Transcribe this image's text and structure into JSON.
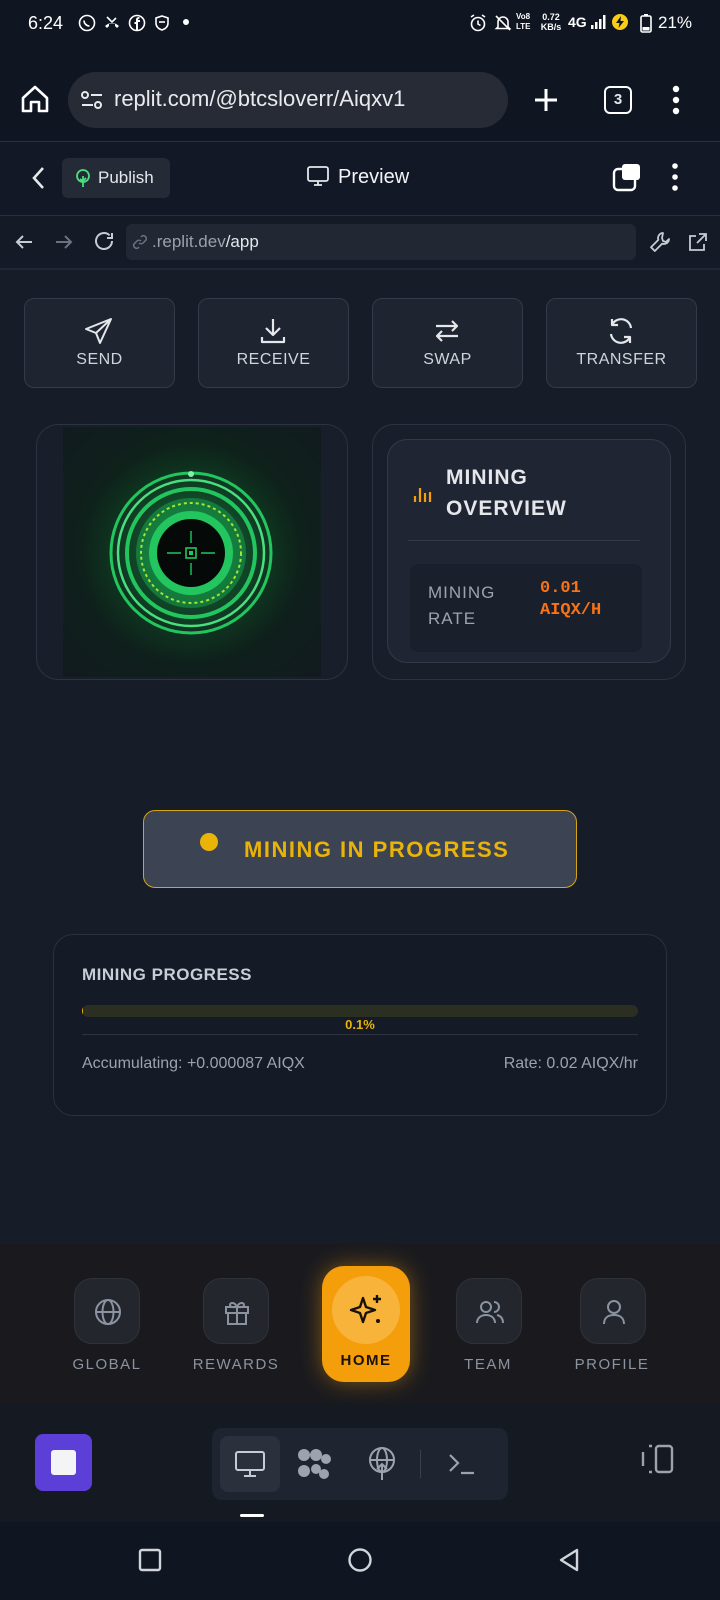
{
  "status_bar": {
    "time": "6:24",
    "network_speed_value": "0.72",
    "network_speed_unit": "KB/s",
    "volte": "Vo8 LTE",
    "signal_type": "4G",
    "battery": "21%"
  },
  "browser": {
    "url": "replit.com/@btcsloverr/Aiqxv1",
    "tab_count": "3"
  },
  "replit_header": {
    "publish_label": "Publish",
    "preview_label": "Preview"
  },
  "preview_bar": {
    "url_domain": ".replit.dev",
    "url_path": "/app"
  },
  "actions": [
    {
      "label": "SEND",
      "icon": "send-icon"
    },
    {
      "label": "RECEIVE",
      "icon": "download-icon"
    },
    {
      "label": "SWAP",
      "icon": "swap-icon"
    },
    {
      "label": "TRANSFER",
      "icon": "refresh-icon"
    }
  ],
  "overview": {
    "title_line1": "MINING",
    "title_line2": "OVERVIEW",
    "rate_label_line1": "MINING",
    "rate_label_line2": "RATE",
    "rate_value_line1": "0.01",
    "rate_value_line2": "AIQX/H"
  },
  "mining_button": {
    "label": "MINING IN PROGRESS"
  },
  "progress": {
    "title": "MINING PROGRESS",
    "percent_label": "0.1%",
    "percent_value": 0.1,
    "accumulating": "Accumulating: +0.000087 AIQX",
    "rate": "Rate: 0.02 AIQX/hr"
  },
  "bottom_nav": [
    {
      "label": "GLOBAL",
      "icon": "globe-icon"
    },
    {
      "label": "REWARDS",
      "icon": "gift-icon"
    },
    {
      "label": "HOME",
      "icon": "sparkles-icon",
      "active": true
    },
    {
      "label": "TEAM",
      "icon": "users-icon"
    },
    {
      "label": "PROFILE",
      "icon": "user-icon"
    }
  ],
  "colors": {
    "accent_yellow": "#eab308",
    "home_orange": "#f59e0b",
    "rate_orange": "#f97316",
    "orb_green": "#22c55e",
    "stop_purple": "#5b3fd6"
  }
}
